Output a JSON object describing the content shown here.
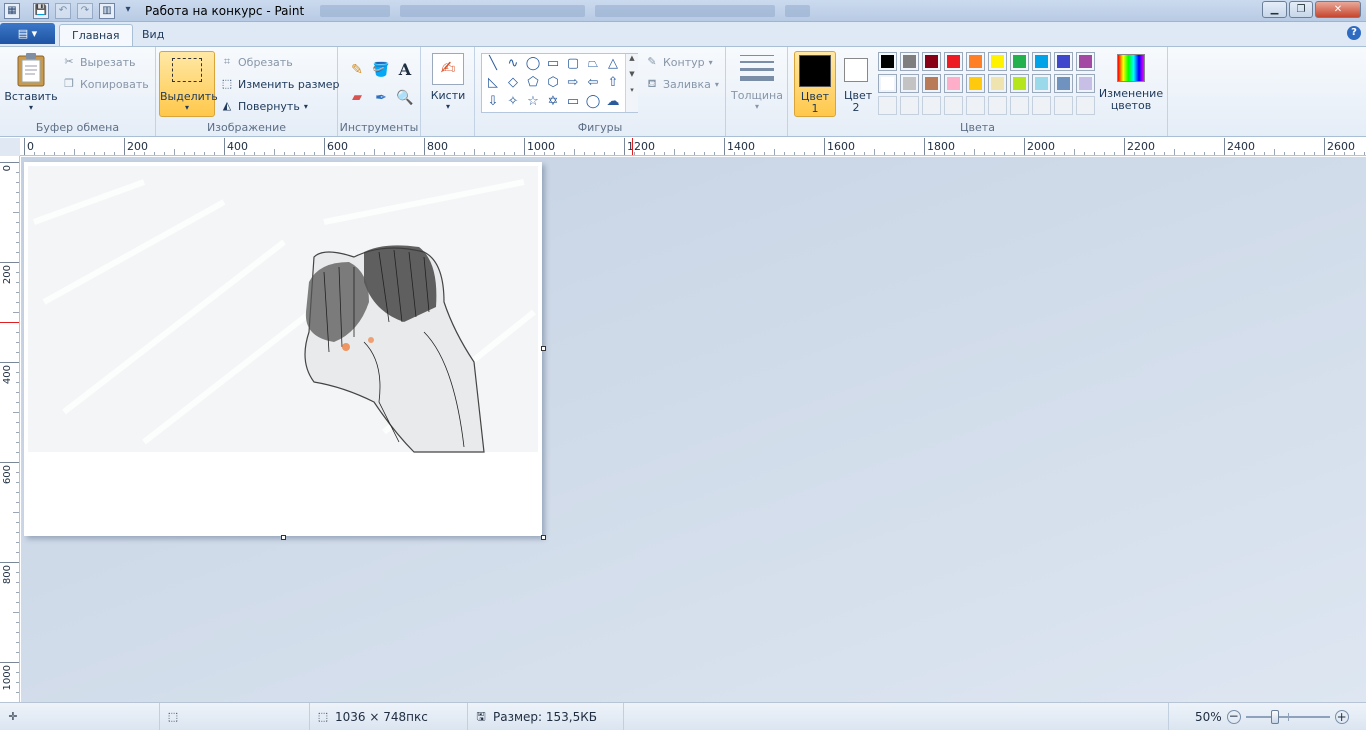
{
  "window": {
    "title": "Работа на конкурс - Paint",
    "minimize": "▁",
    "maximize": "❐",
    "close": "✕"
  },
  "tabs": {
    "app_menu": "▤ ▾",
    "home": "Главная",
    "view": "Вид",
    "help": "?"
  },
  "clipboard": {
    "paste": "Вставить",
    "cut": "Вырезать",
    "copy": "Копировать",
    "label": "Буфер обмена"
  },
  "image": {
    "select": "Выделить",
    "crop": "Обрезать",
    "resize": "Изменить размер",
    "rotate": "Повернуть",
    "label": "Изображение"
  },
  "tools": {
    "label": "Инструменты"
  },
  "brushes": {
    "label": "Кисти"
  },
  "shapes": {
    "outline": "Контур",
    "fill": "Заливка",
    "label": "Фигуры"
  },
  "size": {
    "label": "Толщина"
  },
  "colors": {
    "color1": "Цвет 1",
    "color2": "Цвет 2",
    "edit": "Изменение цветов",
    "label": "Цвета",
    "palette_row1": [
      "#000000",
      "#7f7f7f",
      "#880015",
      "#ed1c24",
      "#ff7f27",
      "#fff200",
      "#22b14c",
      "#00a2e8",
      "#3f48cc",
      "#a349a4"
    ],
    "palette_row2": [
      "#ffffff",
      "#c3c3c3",
      "#b97a57",
      "#ffaec9",
      "#ffc90e",
      "#efe4b0",
      "#b5e61d",
      "#99d9ea",
      "#7092be",
      "#c8bfe7"
    ],
    "color1_value": "#000000",
    "color2_value": "#ffffff"
  },
  "ruler": {
    "top": [
      "0",
      "200",
      "400",
      "600",
      "800",
      "1000",
      "1200",
      "1400",
      "1600",
      "1800",
      "2000",
      "2200",
      "2400",
      "2600"
    ],
    "left": [
      "0",
      "200",
      "400",
      "600",
      "800",
      "1000"
    ]
  },
  "status": {
    "dimensions": "1036 × 748пкс",
    "filesize": "Размер: 153,5КБ",
    "zoom": "50%"
  }
}
